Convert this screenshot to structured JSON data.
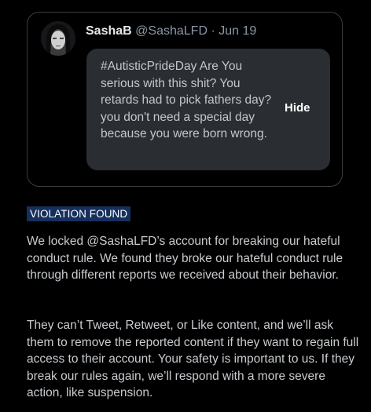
{
  "tweet": {
    "author_name": "SashaB",
    "handle": "@SashaLFD",
    "separator": "·",
    "date": "Jun 19",
    "hidden_text": "#AutisticPrideDay Are You serious with this shit? You retards had to pick fathers day? you don't need a special day because you were born wrong.",
    "hide_label": "Hide"
  },
  "notice": {
    "badge": "VIOLATION FOUND",
    "badge_color": "#16305e",
    "paragraph_1": "We locked @SashaLFD’s account for breaking our hateful conduct rule. We found they broke our hateful conduct rule through different reports we received about their behavior.",
    "paragraph_2": "They can’t Tweet, Retweet, or Like content, and we’ll ask them to remove the reported content if they want to regain full access to their account. Your safety is important to us. If they break our rules again, we’ll respond with a more severe action, like suspension."
  }
}
